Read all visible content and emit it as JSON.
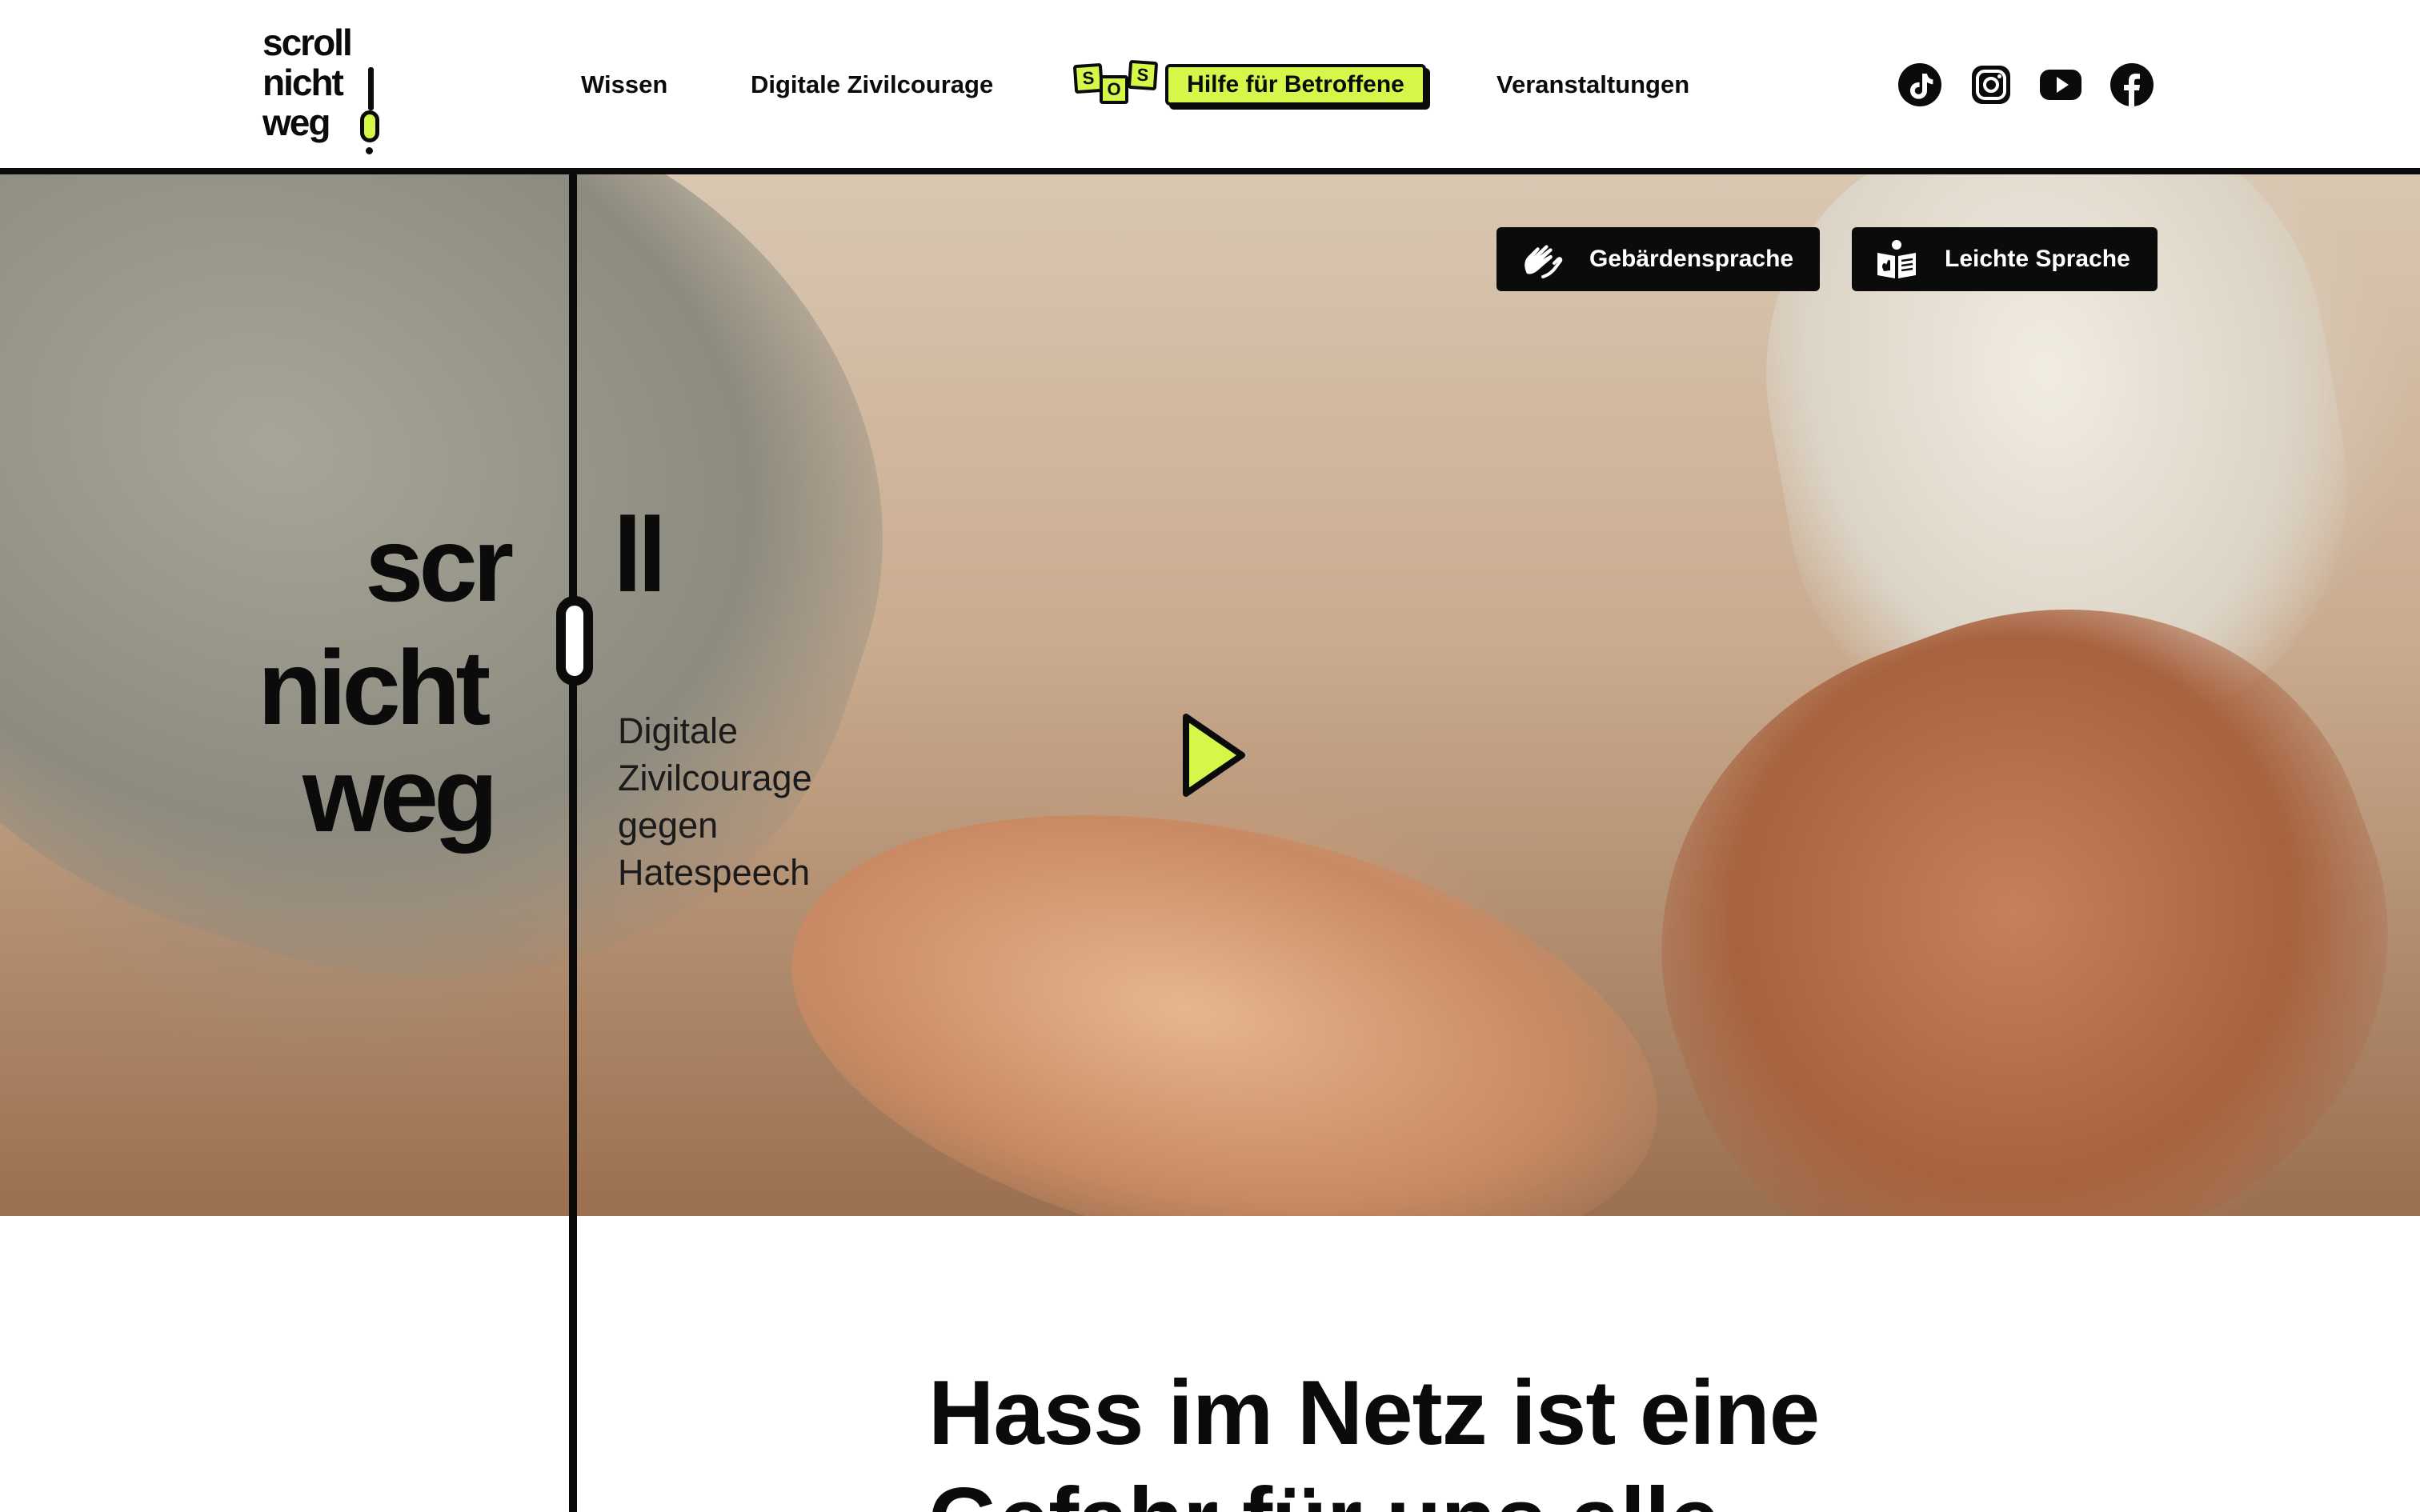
{
  "logo": {
    "line1": "scroll",
    "line2": "nicht",
    "line3": "weg"
  },
  "nav": {
    "items": [
      {
        "label": "Wissen"
      },
      {
        "label": "Digitale Zivilcourage"
      },
      {
        "label": "Veranstaltungen"
      }
    ],
    "sos": {
      "tiles": [
        "S",
        "O",
        "S"
      ],
      "label": "Hilfe für Betroffene"
    }
  },
  "social": [
    {
      "icon": "tiktok-icon"
    },
    {
      "icon": "instagram-icon"
    },
    {
      "icon": "youtube-icon"
    },
    {
      "icon": "facebook-icon"
    }
  ],
  "hero": {
    "logo": {
      "scr": "scr",
      "ll": "ll",
      "nicht": "nicht",
      "weg": "weg"
    },
    "tagline": [
      "Digitale",
      "Zivilcourage",
      "gegen",
      "Hatespeech"
    ],
    "accessibility": {
      "sign_language": "Gebärdensprache",
      "easy_language": "Leichte Sprache"
    },
    "play_icon": "play-icon"
  },
  "main": {
    "headline_lines": [
      "Hass im Netz ist eine",
      "Gefahr für uns alle"
    ]
  },
  "colors": {
    "accent": "#d4f74a",
    "ink": "#0b0b0b",
    "background": "#ffffff"
  }
}
